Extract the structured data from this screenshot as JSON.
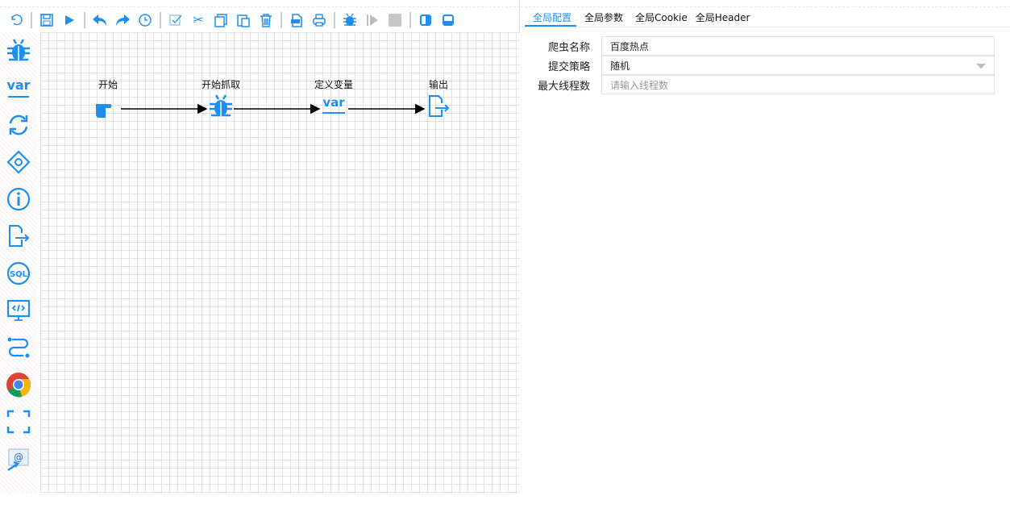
{
  "toolbar": {
    "items": [
      "undo",
      "save",
      "run",
      "undo-arrow",
      "redo",
      "history",
      "select-all",
      "cut",
      "copy",
      "paste",
      "delete",
      "export",
      "print",
      "debug",
      "step",
      "stop",
      "panel-right",
      "panel-bottom"
    ]
  },
  "sidebar": {
    "items": [
      "spider",
      "var",
      "loop",
      "condition",
      "info",
      "output",
      "sql",
      "code",
      "process",
      "chrome",
      "screenshot",
      "email"
    ]
  },
  "canvas": {
    "nodes": [
      {
        "label": "开始",
        "icon": "hand-pointer-icon"
      },
      {
        "label": "开始抓取",
        "icon": "bug-icon"
      },
      {
        "label": "定义变量",
        "icon": "var-icon"
      },
      {
        "label": "输出",
        "icon": "file-export-icon"
      }
    ]
  },
  "panel": {
    "tabs": [
      "全局配置",
      "全局参数",
      "全局Cookie",
      "全局Header"
    ],
    "fields": [
      {
        "label": "爬虫名称",
        "value": "百度热点"
      },
      {
        "label": "提交策略",
        "value": "随机"
      },
      {
        "label": "最大线程数",
        "placeholder": "请输入线程数"
      }
    ]
  },
  "colors": {
    "accent": "#1e8ef0"
  }
}
